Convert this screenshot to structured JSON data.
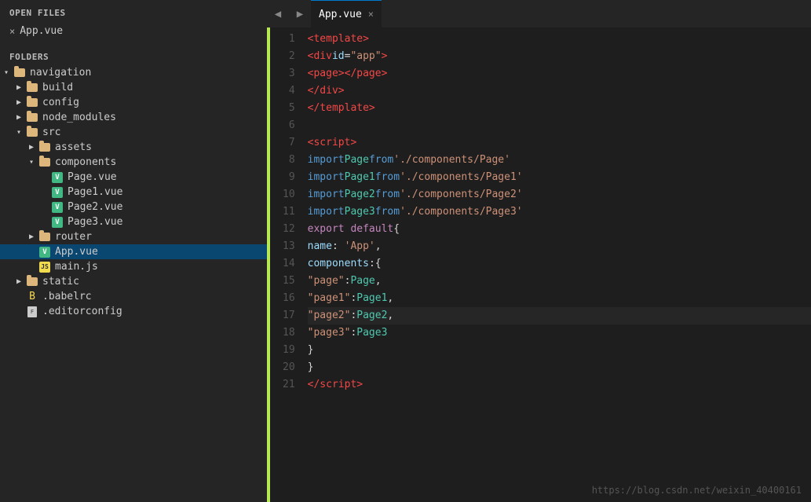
{
  "sidebar": {
    "open_files_title": "OPEN FILES",
    "folders_title": "FOLDERS",
    "open_files": [
      {
        "name": "App.vue",
        "close": "×"
      }
    ],
    "tree": {
      "root": "navigation",
      "items": [
        {
          "id": "navigation",
          "label": "navigation",
          "type": "folder",
          "level": 0,
          "expanded": true,
          "arrow": "▾"
        },
        {
          "id": "build",
          "label": "build",
          "type": "folder",
          "level": 1,
          "expanded": false,
          "arrow": "▶"
        },
        {
          "id": "config",
          "label": "config",
          "type": "folder",
          "level": 1,
          "expanded": false,
          "arrow": "▶"
        },
        {
          "id": "node_modules",
          "label": "node_modules",
          "type": "folder",
          "level": 1,
          "expanded": false,
          "arrow": "▶"
        },
        {
          "id": "src",
          "label": "src",
          "type": "folder",
          "level": 1,
          "expanded": true,
          "arrow": "▾"
        },
        {
          "id": "assets",
          "label": "assets",
          "type": "folder",
          "level": 2,
          "expanded": false,
          "arrow": "▶"
        },
        {
          "id": "components",
          "label": "components",
          "type": "folder",
          "level": 2,
          "expanded": true,
          "arrow": "▾"
        },
        {
          "id": "Page.vue",
          "label": "Page.vue",
          "type": "vue",
          "level": 3
        },
        {
          "id": "Page1.vue",
          "label": "Page1.vue",
          "type": "vue",
          "level": 3
        },
        {
          "id": "Page2.vue",
          "label": "Page2.vue",
          "type": "vue",
          "level": 3
        },
        {
          "id": "Page3.vue",
          "label": "Page3.vue",
          "type": "vue",
          "level": 3
        },
        {
          "id": "router",
          "label": "router",
          "type": "folder",
          "level": 2,
          "expanded": false,
          "arrow": "▶"
        },
        {
          "id": "App.vue",
          "label": "App.vue",
          "type": "vue",
          "level": 2,
          "active": true
        },
        {
          "id": "main.js",
          "label": "main.js",
          "type": "js",
          "level": 2
        },
        {
          "id": "static",
          "label": "static",
          "type": "folder",
          "level": 1,
          "expanded": false,
          "arrow": "▶"
        },
        {
          "id": ".babelrc",
          "label": ".babelrc",
          "type": "babel",
          "level": 1
        },
        {
          "id": ".editorconfig",
          "label": ".editorconfig",
          "type": "file",
          "level": 1
        }
      ]
    }
  },
  "editor": {
    "tab": {
      "name": "App.vue",
      "close": "×"
    },
    "lines": [
      {
        "num": 1,
        "html": "<span class='c-tag'>&lt;template&gt;</span>"
      },
      {
        "num": 2,
        "html": "  <span class='c-tag'>&lt;div</span> <span class='c-attr'>id</span><span class='c-white'>=</span><span class='c-str'>\"app\"</span><span class='c-tag'>&gt;</span>"
      },
      {
        "num": 3,
        "html": "    <span class='c-tag'>&lt;page&gt;&lt;/page&gt;</span>"
      },
      {
        "num": 4,
        "html": "  <span class='c-tag'>&lt;/div&gt;</span>"
      },
      {
        "num": 5,
        "html": "<span class='c-tag'>&lt;/template&gt;</span>"
      },
      {
        "num": 6,
        "html": ""
      },
      {
        "num": 7,
        "html": "<span class='c-tag'>&lt;script&gt;</span>"
      },
      {
        "num": 8,
        "html": "<span class='c-import'>import</span> <span class='c-ident'>Page</span> <span class='c-import'>from</span> <span class='c-str'>'./components/Page'</span>"
      },
      {
        "num": 9,
        "html": "<span class='c-import'>import</span> <span class='c-ident'>Page1</span> <span class='c-import'>from</span> <span class='c-str'>'./components/Page1'</span>"
      },
      {
        "num": 10,
        "html": "<span class='c-import'>import</span> <span class='c-ident'>Page2</span> <span class='c-import'>from</span> <span class='c-str'>'./components/Page2'</span>"
      },
      {
        "num": 11,
        "html": "<span class='c-import'>import</span> <span class='c-ident'>Page3</span> <span class='c-import'>from</span> <span class='c-str'>'./components/Page3'</span>"
      },
      {
        "num": 12,
        "html": "<span class='c-export'>export default</span> <span class='c-white'>{</span>"
      },
      {
        "num": 13,
        "html": "  <span class='c-prop'>name</span><span class='c-white'>: </span><span class='c-str'>'App'</span><span class='c-white'>,</span>"
      },
      {
        "num": 14,
        "html": "  <span class='c-prop'>components</span><span class='c-white'>:{</span>"
      },
      {
        "num": 15,
        "html": "    <span class='c-str'>\"page\"</span><span class='c-white'>:</span><span class='c-ident'>Page</span><span class='c-white'>,</span>"
      },
      {
        "num": 16,
        "html": "    <span class='c-str'>\"page1\"</span><span class='c-white'>:</span><span class='c-ident'>Page1</span><span class='c-white'>,</span>"
      },
      {
        "num": 17,
        "html": "    <span class='c-str'>\"page2\"</span><span class='c-white'>:</span><span class='c-ident'>Page2</span><span class='c-white'>,</span>",
        "cursor": true
      },
      {
        "num": 18,
        "html": "    <span class='c-str'>\"page3\"</span><span class='c-white'>:</span><span class='c-ident'>Page3</span>"
      },
      {
        "num": 19,
        "html": "  <span class='c-white'>}</span>"
      },
      {
        "num": 20,
        "html": "<span class='c-white'>}</span>"
      },
      {
        "num": 21,
        "html": "<span class='c-tag'>&lt;/script&gt;</span>"
      }
    ],
    "watermark": "https://blog.csdn.net/weixin_40400161"
  },
  "colors": {
    "accent_bar": "#b5e853",
    "active_tab_border": "#007acc",
    "sidebar_bg": "#252526",
    "editor_bg": "#1e1e1e"
  }
}
